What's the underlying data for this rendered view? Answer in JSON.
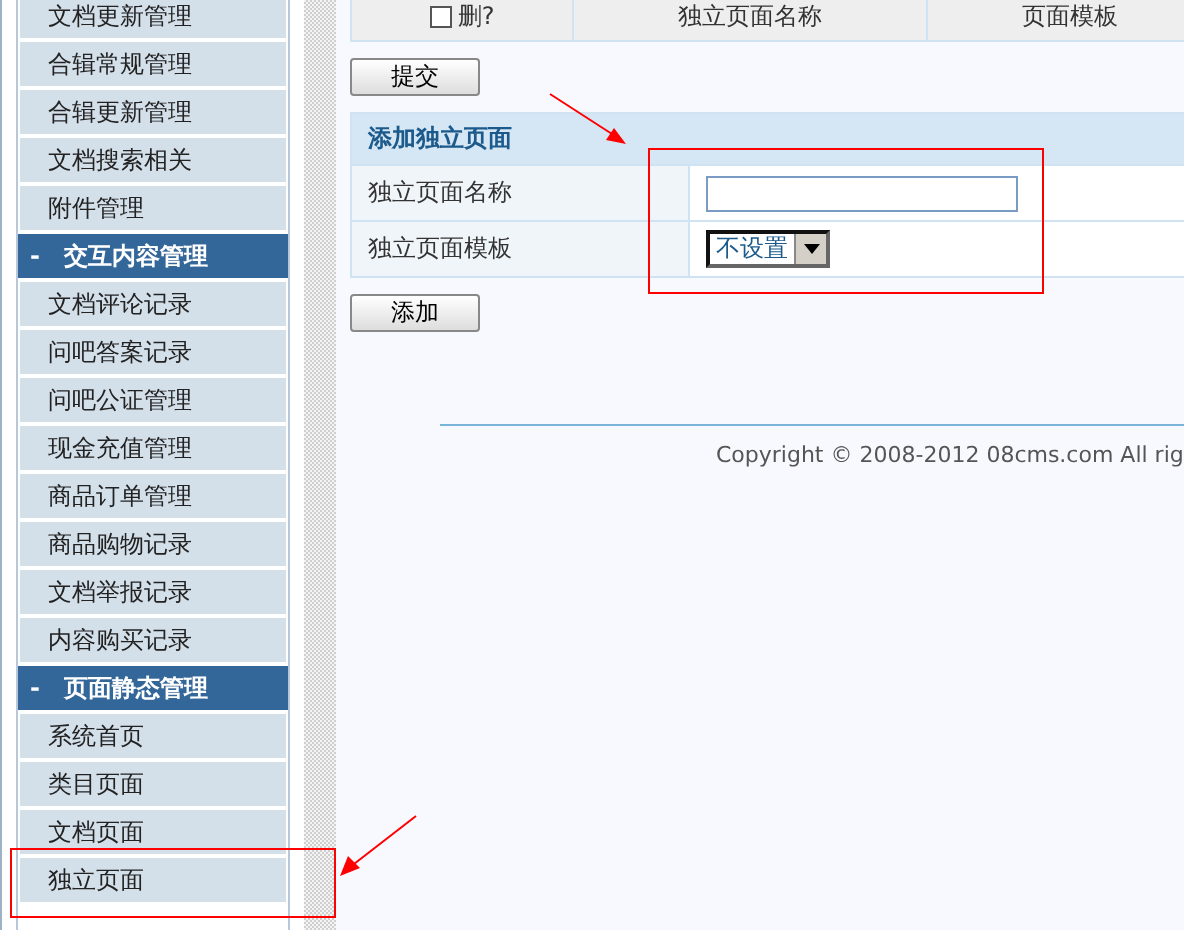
{
  "sidebar": {
    "items": [
      {
        "kind": "item",
        "label": "文档更新管理"
      },
      {
        "kind": "item",
        "label": "合辑常规管理"
      },
      {
        "kind": "item",
        "label": "合辑更新管理"
      },
      {
        "kind": "item",
        "label": "文档搜索相关"
      },
      {
        "kind": "item",
        "label": "附件管理"
      },
      {
        "kind": "header",
        "label": "交互内容管理",
        "toggle": "-"
      },
      {
        "kind": "item",
        "label": "文档评论记录"
      },
      {
        "kind": "item",
        "label": "问吧答案记录"
      },
      {
        "kind": "item",
        "label": "问吧公证管理"
      },
      {
        "kind": "item",
        "label": "现金充值管理"
      },
      {
        "kind": "item",
        "label": "商品订单管理"
      },
      {
        "kind": "item",
        "label": "商品购物记录"
      },
      {
        "kind": "item",
        "label": "文档举报记录"
      },
      {
        "kind": "item",
        "label": "内容购买记录"
      },
      {
        "kind": "header",
        "label": "页面静态管理",
        "toggle": "-"
      },
      {
        "kind": "item",
        "label": "系统首页"
      },
      {
        "kind": "item",
        "label": "类目页面"
      },
      {
        "kind": "item",
        "label": "文档页面"
      },
      {
        "kind": "item",
        "label": "独立页面"
      }
    ]
  },
  "table": {
    "select_all": {
      "label": "删?",
      "checked": false
    },
    "columns": [
      "独立页面名称",
      "页面模板"
    ]
  },
  "submit_button": "提交",
  "add_form": {
    "title": "添加独立页面",
    "name_label": "独立页面名称",
    "template_label": "独立页面模板",
    "template_value": "不设置"
  },
  "add_button": "添加",
  "footer": "Copyright © 2008-2012 08cms.com All rig"
}
